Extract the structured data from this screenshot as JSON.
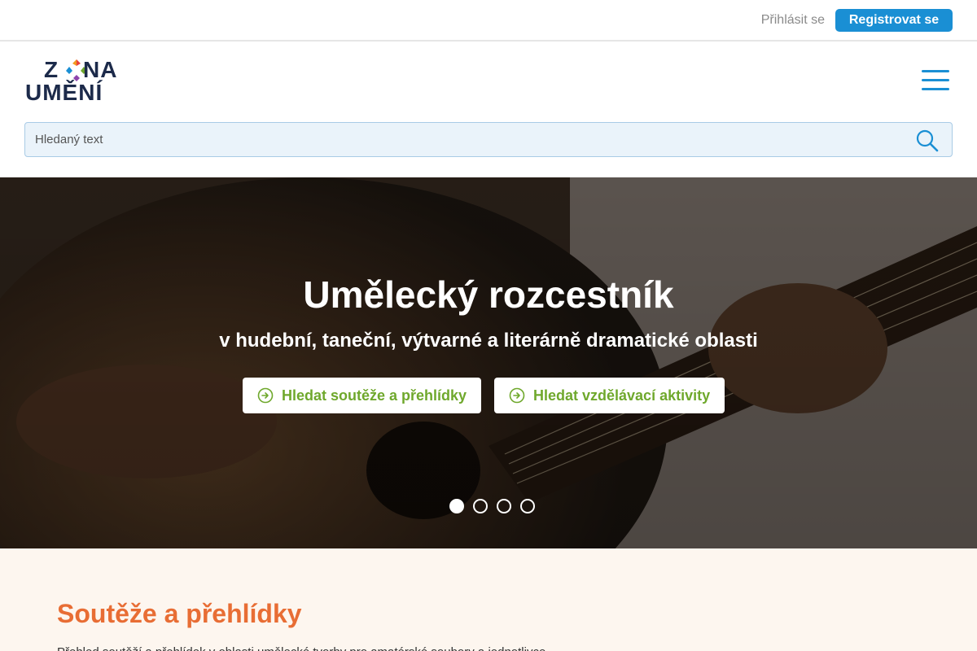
{
  "topbar": {
    "login_label": "Přihlásit se",
    "register_label": "Registrovat se"
  },
  "logo": {
    "row1": "ZONA",
    "row2": "UMĚNÍ",
    "colors": [
      "#e8413c",
      "#f39a1f",
      "#1a8fd4",
      "#6fa82c",
      "#8e44ad"
    ]
  },
  "search": {
    "placeholder": "Hledaný text"
  },
  "hero": {
    "title": "Umělecký rozcestník",
    "subtitle": "v hudební, taneční, výtvarné a literárně dramatické oblasti",
    "buttons": [
      {
        "label": "Hledat soutěže a přehlídky"
      },
      {
        "label": "Hledat vzdělávací aktivity"
      }
    ],
    "slides_total": 4,
    "active_slide": 1
  },
  "section": {
    "title": "Soutěže a přehlídky",
    "text": "Přehled soutěží a přehlídek v oblasti umělecké tvorby pro amatérské soubory a jednotlivce"
  },
  "colors": {
    "accent_blue": "#1a8fd4",
    "accent_green": "#6fa82c",
    "accent_orange": "#e86d34"
  }
}
